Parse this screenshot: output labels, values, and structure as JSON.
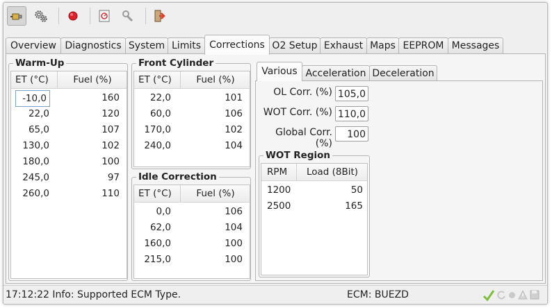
{
  "toolbar": {
    "buttons": [
      {
        "name": "connect-icon"
      },
      {
        "name": "settings-icon"
      },
      {
        "name": "record-icon"
      },
      {
        "name": "log-icon"
      },
      {
        "name": "tools-icon"
      },
      {
        "name": "exit-icon"
      }
    ]
  },
  "tabs": [
    "Overview",
    "Diagnostics",
    "System",
    "Limits",
    "Corrections",
    "O2 Setup",
    "Exhaust",
    "Maps",
    "EEPROM",
    "Messages"
  ],
  "active_tab": "Corrections",
  "warmup": {
    "title": "Warm-Up",
    "col1": "ET (°C)",
    "col2": "Fuel (%)",
    "rows": [
      [
        "-10,0",
        "160"
      ],
      [
        "22,0",
        "120"
      ],
      [
        "65,0",
        "107"
      ],
      [
        "130,0",
        "102"
      ],
      [
        "180,0",
        "100"
      ],
      [
        "245,0",
        "97"
      ],
      [
        "260,0",
        "110"
      ]
    ]
  },
  "front_cylinder": {
    "title": "Front Cylinder",
    "col1": "ET (°C)",
    "col2": "Fuel (%)",
    "rows": [
      [
        "22,0",
        "101"
      ],
      [
        "60,0",
        "106"
      ],
      [
        "170,0",
        "102"
      ],
      [
        "240,0",
        "104"
      ]
    ]
  },
  "idle_correction": {
    "title": "Idle Correction",
    "col1": "ET (°C)",
    "col2": "Fuel (%)",
    "rows": [
      [
        "0,0",
        "106"
      ],
      [
        "62,0",
        "104"
      ],
      [
        "160,0",
        "100"
      ],
      [
        "215,0",
        "100"
      ]
    ]
  },
  "inner_tabs": [
    "Various",
    "Acceleration",
    "Deceleration"
  ],
  "various": {
    "ol_label": "OL Corr. (%)",
    "ol_value": "105,0",
    "wot_label": "WOT Corr. (%)",
    "wot_value": "110,0",
    "global_label": "Global Corr. (%)",
    "global_value": "100"
  },
  "wot_region": {
    "title": "WOT Region",
    "col1": "RPM",
    "col2": "Load (8Bit)",
    "rows": [
      [
        "1200",
        "50"
      ],
      [
        "2500",
        "165"
      ]
    ]
  },
  "status": {
    "message": "17:12:22 Info: Supported ECM Type.",
    "ecm": "ECM: BUEZD"
  },
  "colors": {
    "record": "#e0202a",
    "check": "#7cbf3a",
    "exit_arrow": "#d8402a"
  }
}
